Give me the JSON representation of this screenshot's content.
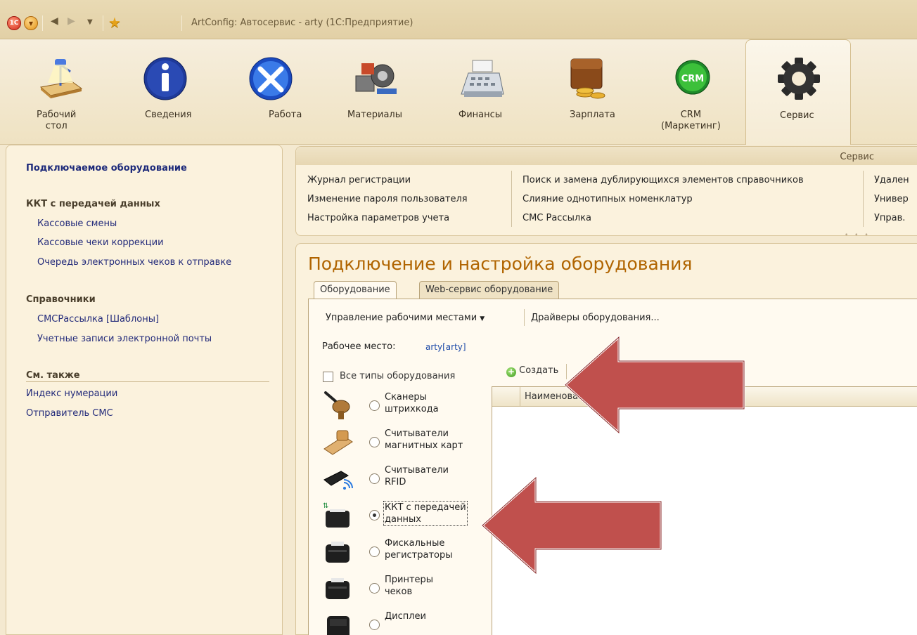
{
  "window": {
    "title": "ArtConfig: Автосервис - arty  (1С:Предприятие)"
  },
  "sections": [
    {
      "label": "Рабочий\nстол",
      "icon": "desk-lamp-icon"
    },
    {
      "label": "Сведения",
      "icon": "info-icon"
    },
    {
      "label": "Работа",
      "icon": "tools-icon"
    },
    {
      "label": "Материалы",
      "icon": "parts-icon"
    },
    {
      "label": "Финансы",
      "icon": "cash-register-icon"
    },
    {
      "label": "Зарплата",
      "icon": "wallet-icon"
    },
    {
      "label": "CRM\n(Маркетинг)",
      "icon": "crm-icon",
      "icon_text": "CRM"
    },
    {
      "label": "Сервис",
      "icon": "gear-icon"
    }
  ],
  "leftnav": {
    "title": "Подключаемое оборудование",
    "groups": [
      {
        "title": "ККТ с передачей данных",
        "items": [
          "Кассовые смены",
          "Кассовые чеки коррекции",
          "Очередь электронных чеков к отправке"
        ]
      },
      {
        "title": "Справочники",
        "items": [
          "СМСРассылка [Шаблоны]",
          "Учетные записи электронной почты"
        ]
      },
      {
        "title": "См. также",
        "items": [
          "Индекс нумерации",
          "Отправитель СМС"
        ]
      }
    ]
  },
  "service_panel": {
    "title": "Сервис",
    "columns": [
      [
        "Журнал регистрации",
        "Изменение пароля пользователя",
        "Настройка параметров учета"
      ],
      [
        "Поиск и замена дублирующихся элементов справочников",
        "Слияние однотипных номенклатур",
        "СМС Рассылка"
      ],
      [
        "Удален",
        "Универ",
        "Управ."
      ]
    ]
  },
  "form": {
    "title": "Подключение и настройка оборудования",
    "tabs": [
      "Оборудование",
      "Web-сервис оборудование"
    ],
    "commands": {
      "workplaces": "Управление рабочими местами",
      "drivers": "Драйверы оборудования..."
    },
    "workplace_label": "Рабочее место:",
    "workplace_value": "arty[arty]",
    "all_types_label": "Все типы оборудования",
    "create_label": "Создать",
    "grid_column": "Наименовани",
    "equipment_types": [
      {
        "name": "Сканеры\nштрихкода",
        "checked": false,
        "icon": "barcode-scanner-icon"
      },
      {
        "name": "Считыватели\nмагнитных карт",
        "checked": false,
        "icon": "card-reader-icon"
      },
      {
        "name": "Считыватели\nRFID",
        "checked": false,
        "icon": "rfid-reader-icon"
      },
      {
        "name": "ККТ с передачей\nданных",
        "checked": true,
        "icon": "online-kkt-icon"
      },
      {
        "name": "Фискальные\nрегистраторы",
        "checked": false,
        "icon": "fiscal-printer-icon"
      },
      {
        "name": "Принтеры\nчеков",
        "checked": false,
        "icon": "receipt-printer-icon"
      },
      {
        "name": "Дисплеи",
        "checked": false,
        "icon": "display-icon"
      }
    ]
  },
  "colors": {
    "accent_title": "#b06400",
    "link": "#222a7a",
    "arrow": "#c0504d"
  }
}
